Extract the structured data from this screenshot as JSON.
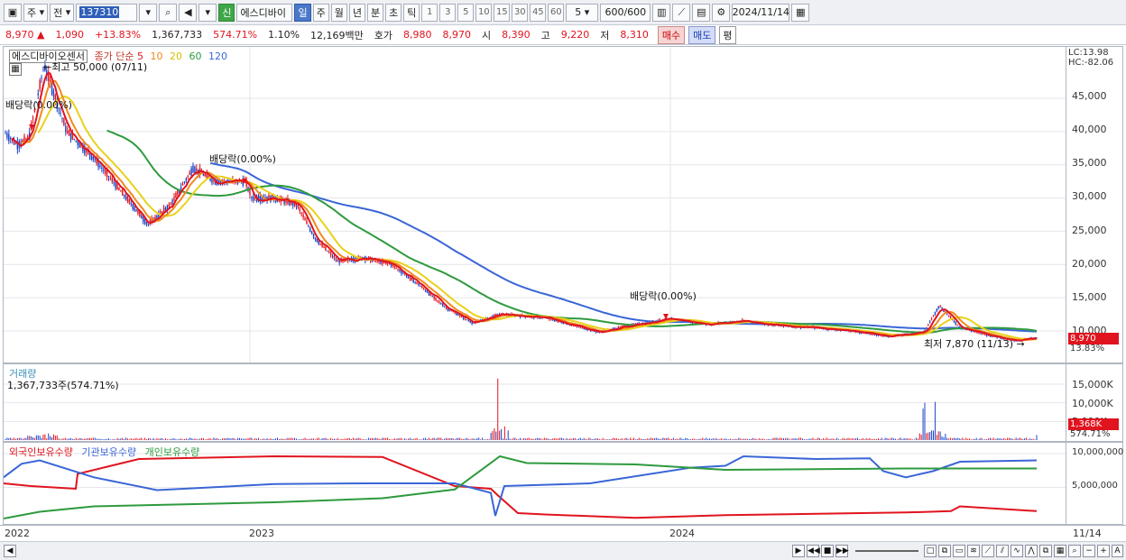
{
  "toolbar": {
    "period_main": "주",
    "period_prev": "전",
    "stock_code": "137310",
    "new_badge": "신",
    "stock_name": "에스디바이",
    "period_tabs": [
      "일",
      "주",
      "월",
      "년",
      "분",
      "초",
      "틱"
    ],
    "active_tab": "일",
    "intervals": [
      "1",
      "3",
      "5",
      "10",
      "15",
      "30",
      "45",
      "60"
    ],
    "count_select": "5",
    "data_count": "600",
    "data_total": "/600",
    "date": "2024/11/14"
  },
  "info": {
    "price": "8,970",
    "change": "1,090",
    "change_pct": "+13.83%",
    "volume": "1,367,733",
    "volume_pct": "574.71%",
    "turnover": "1.10%",
    "amount": "12,169백만",
    "quote_label": "호가",
    "ask": "8,980",
    "bid": "8,970",
    "open_label": "시",
    "open": "8,390",
    "high_label": "고",
    "high": "9,220",
    "low_label": "저",
    "low": "8,310",
    "buy_label": "매수",
    "sell_label": "매도",
    "eval_label": "평"
  },
  "price_panel": {
    "title": "에스디바이오센서",
    "ma_legend_label": "종가 단순",
    "ma_periods": [
      {
        "label": "5",
        "color": "#e0141e"
      },
      {
        "label": "10",
        "color": "#f08a1e"
      },
      {
        "label": "20",
        "color": "#e8d21a"
      },
      {
        "label": "60",
        "color": "#2e9a3e"
      },
      {
        "label": "120",
        "color": "#3a66d6"
      }
    ],
    "high_marker": "←최고 50,000 (07/11)",
    "low_marker": "최저 7,870 (11/13) →",
    "dividend_1": "배당락(0.00%)",
    "dividend_2": "배당락(0.00%)",
    "dividend_3": "배당락(0.00%)",
    "lc": "LC:13.98",
    "hc": "HC:-82.06",
    "y_ticks": [
      "45,000",
      "40,000",
      "35,000",
      "30,000",
      "25,000",
      "20,000",
      "15,000",
      "10,000"
    ],
    "last_price": "8,970",
    "last_pct": "13.83%"
  },
  "volume_panel": {
    "title": "거래량",
    "sub": "1,367,733주(574.71%)",
    "y_ticks": [
      "15,000K",
      "10,000K",
      "5,000K"
    ],
    "last_vol": "1,368K",
    "last_pct": "574.71%"
  },
  "holdings_panel": {
    "foreign_label": "외국인보유수량",
    "inst_label": "기관보유수량",
    "retail_label": "개인보유수량",
    "y_ticks": [
      "10,000,000",
      "5,000,000"
    ]
  },
  "x_axis": {
    "labels": [
      "2022",
      "2023",
      "2024"
    ],
    "last_label": "11/14"
  },
  "colors": {
    "up": "#e0141e",
    "down": "#1a44c8",
    "ma5": "#e0141e",
    "ma10": "#f08a1e",
    "ma20": "#e8d21a",
    "ma60": "#2e9a3e",
    "ma120": "#3a66d6",
    "foreign": "#e0141e",
    "inst": "#3a66d6",
    "retail": "#2e9a3e"
  }
}
